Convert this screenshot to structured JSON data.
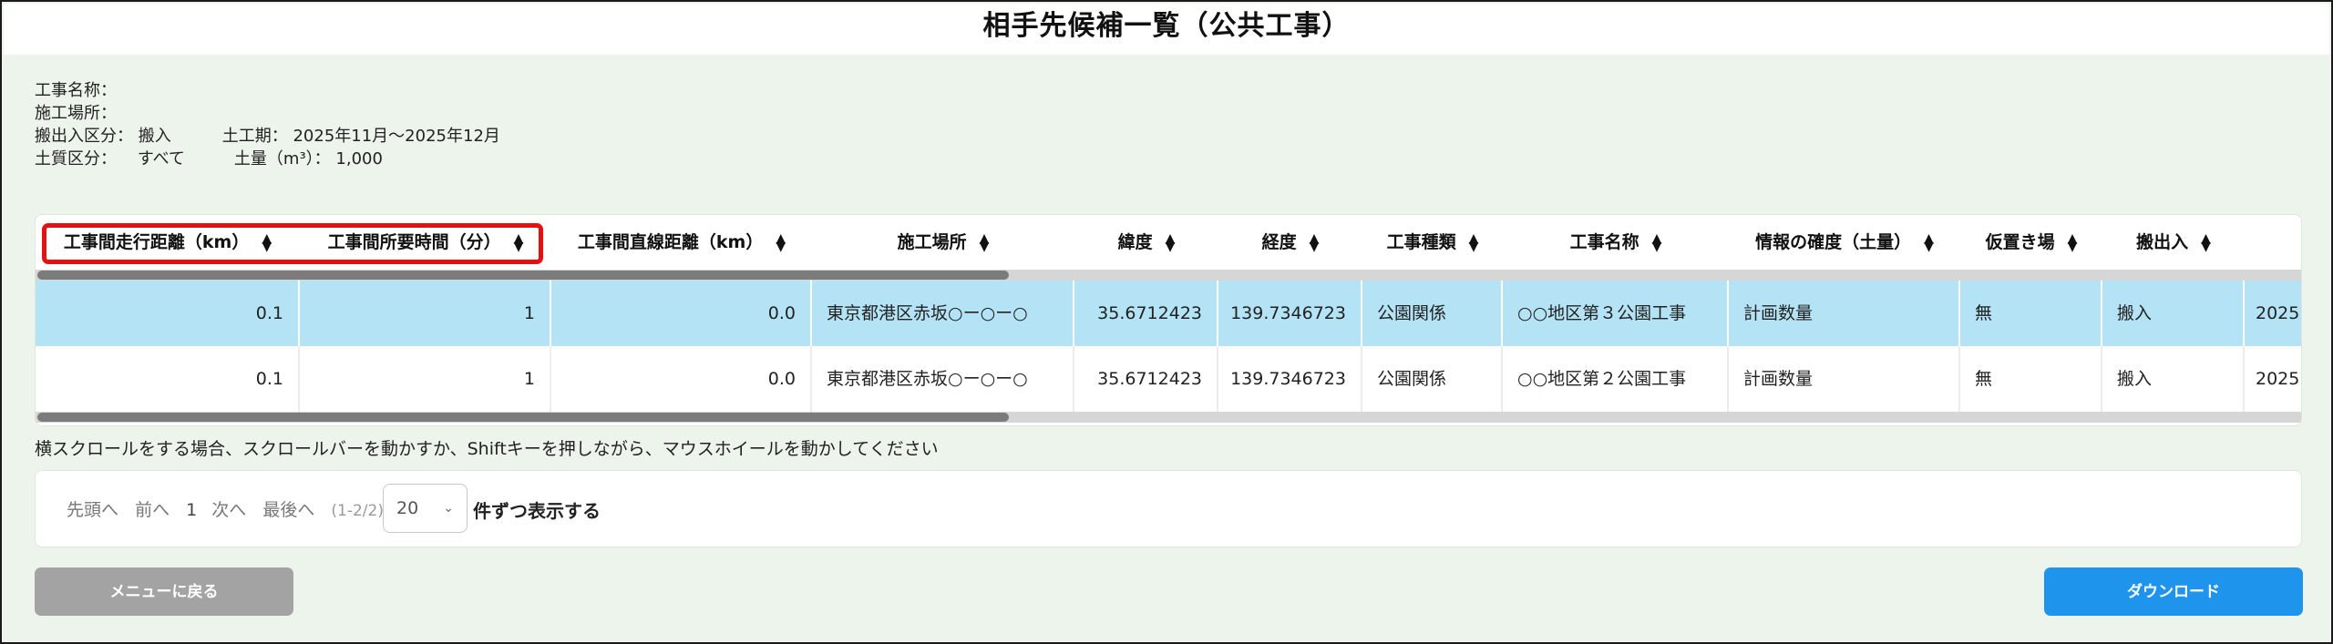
{
  "page": {
    "title": "相手先候補一覧（公共工事）"
  },
  "info": {
    "koji_name_label": "工事名称：",
    "sekou_basho_label": "施工場所：",
    "hanshutsu_label": "搬出入区分：",
    "hanshutsu_value": "搬入",
    "kouki_label": "土工期：",
    "kouki_value": "2025年11月～2025年12月",
    "doshitsu_label": "土質区分：",
    "doshitsu_value": "すべて",
    "doryou_label": "土量（m³）：",
    "doryou_value": "1,000"
  },
  "table": {
    "columns": [
      "工事間走行距離（km）",
      "工事間所要時間（分）",
      "工事間直線距離（km）",
      "施工場所",
      "緯度",
      "経度",
      "工事種類",
      "工事名称",
      "情報の確度（土量）",
      "仮置き場",
      "搬出入"
    ],
    "sort_up": "▲",
    "sort_down": "▼",
    "rows": [
      [
        "0.1",
        "1",
        "0.0",
        "東京都港区赤坂○ー○ー○",
        "35.6712423",
        "139.7346723",
        "公園関係",
        "○○地区第３公園工事",
        "計画数量",
        "無",
        "搬入",
        "2025"
      ],
      [
        "0.1",
        "1",
        "0.0",
        "東京都港区赤坂○ー○ー○",
        "35.6712423",
        "139.7346723",
        "公園関係",
        "○○地区第２公園工事",
        "計画数量",
        "無",
        "搬入",
        "2025"
      ]
    ]
  },
  "scroll_hint": "横スクロールをする場合、スクロールバーを動かすか、Shiftキーを押しながら、マウスホイールを動かしてください",
  "pager": {
    "first": "先頭へ",
    "prev": "前へ",
    "current": "1",
    "next": "次へ",
    "last": "最後へ",
    "range": "(1-2/2)",
    "page_size": "20",
    "per_page_label": "件ずつ表示する"
  },
  "buttons": {
    "back": "メニューに戻る",
    "download": "ダウンロード"
  },
  "colors": {
    "selected_row": "#b4e3f6",
    "highlight_border": "#e31111",
    "download_button": "#1f94ec",
    "back_button": "#a3a3a3",
    "background": "#edf4ec"
  }
}
